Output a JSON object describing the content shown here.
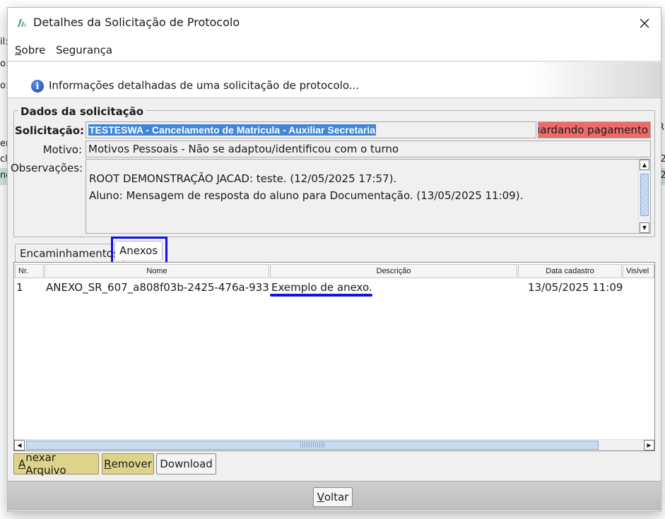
{
  "window": {
    "title": "Detalhes da Solicitação de Protocolo"
  },
  "menu": {
    "sobre": {
      "accel": "S",
      "rest": "obre"
    },
    "seguranca": {
      "label": "Segurança"
    }
  },
  "banner": {
    "text": "Informações detalhadas de uma solicitação de protocolo..."
  },
  "group": {
    "title": "Dados da solicitação",
    "solicitacao_label": "Solicitação:",
    "solicitacao_value": "TESTESWA - Cancelamento de Matricula - Auxiliar Secretaria",
    "status_value": "uardando pagamento",
    "motivo_label": "Motivo:",
    "motivo_value": "Motivos Pessoais - Não se adaptou/identificou com o turno",
    "observacoes_label": "Observações:",
    "observacoes_lines": [
      "ROOT DEMONSTRAÇÃO JACAD: teste. (12/05/2025 17:57).",
      "Aluno: Mensagem de resposta do aluno para Documentação. (13/05/2025 11:09)."
    ]
  },
  "tabs": [
    {
      "label": "Encaminhamentos"
    },
    {
      "label": "Anexos",
      "active": true
    }
  ],
  "table": {
    "columns": [
      "Nr.",
      "Nome",
      "Descrição",
      "Data cadastro",
      "Visível"
    ],
    "rows": [
      {
        "nr": "1",
        "nome": "ANEXO_SR_607_a808f03b-2425-476a-9335...",
        "descricao": "Exemplo de anexo.",
        "data_cadastro": "13/05/2025 11:09",
        "visivel": ""
      }
    ]
  },
  "buttons": {
    "anexar": {
      "accel": "A",
      "rest": "nexar Arquivo"
    },
    "remover": {
      "accel": "R",
      "rest": "emover"
    },
    "download": {
      "label": "Download"
    },
    "voltar": {
      "accel": "V",
      "rest": "oltar"
    }
  },
  "colors": {
    "status_bg": "#ef6b6b",
    "selection": "#3f86d9",
    "highlight": "#1010e8",
    "yellow_button": "#ded38a"
  },
  "background_fragments": [
    "il:",
    "o:",
    "o:",
    "er",
    "cl",
    "nc",
    "R",
    "/2",
    "/2"
  ]
}
